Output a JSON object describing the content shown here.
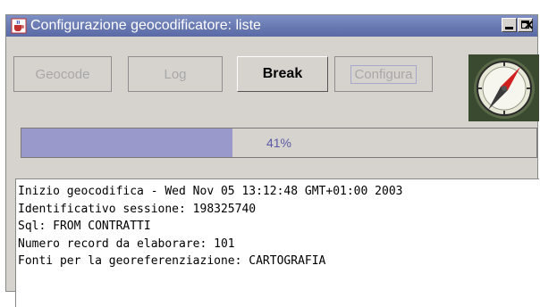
{
  "window": {
    "title": "Configurazione geocodificatore: liste",
    "controls": {
      "close": "×"
    }
  },
  "toolbar": {
    "buttons": [
      {
        "label": "Geocode",
        "enabled": false
      },
      {
        "label": "Log",
        "enabled": false
      },
      {
        "label": "Break",
        "enabled": true
      },
      {
        "label": "Configura",
        "enabled": false
      }
    ]
  },
  "progress": {
    "value": 0.41,
    "label": "41%"
  },
  "log": {
    "lines": [
      "Inizio geocodifica - Wed Nov 05 13:12:48 GMT+01:00 2003",
      "Identificativo sessione: 198325740",
      "Sql: FROM CONTRATTI",
      "Numero record da elaborare: 101",
      "Fonti per la georeferenziazione: CARTOGRAFIA"
    ]
  },
  "icons": {
    "app": "java-cup-icon",
    "compass": "compass-icon"
  },
  "colors": {
    "titlebar": "#6677b0",
    "progress_fill": "#9999cc",
    "progress_text": "#5a5aa6"
  }
}
